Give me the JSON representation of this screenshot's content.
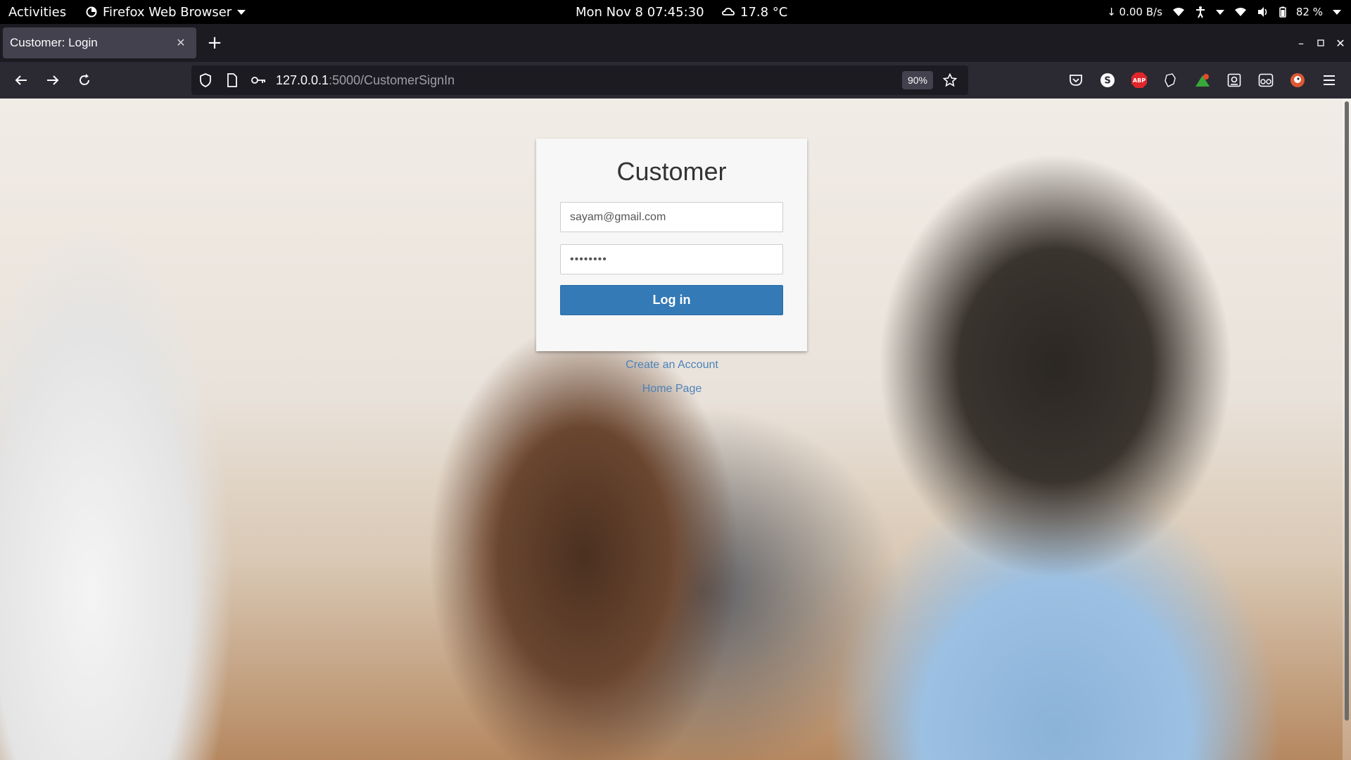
{
  "system_bar": {
    "activities": "Activities",
    "app_name": "Firefox Web Browser",
    "clock": "Mon Nov 8  07:45:30",
    "weather": "17.8 °C",
    "network_speed": "↓ 0.00 B/s",
    "battery": "82 %"
  },
  "browser": {
    "tab_title": "Customer: Login",
    "url_host": "127.0.0.1",
    "url_path": ":5000/CustomerSignIn",
    "zoom": "90%",
    "extensions": [
      "pocket-icon",
      "s-extension-icon",
      "adblock-plus-icon",
      "dark-mode-icon",
      "green-extension-icon",
      "reader-icon",
      "glasses-icon",
      "duckduckgo-icon"
    ]
  },
  "login": {
    "title": "Customer",
    "email_value": "sayam@gmail.com",
    "password_mask": "••••••••",
    "login_button": "Log in",
    "create_account": "Create an Account",
    "home_page": "Home Page"
  },
  "colors": {
    "primary_button": "#337ab7",
    "link": "#4b82b8",
    "browser_chrome": "#2b2a33"
  }
}
